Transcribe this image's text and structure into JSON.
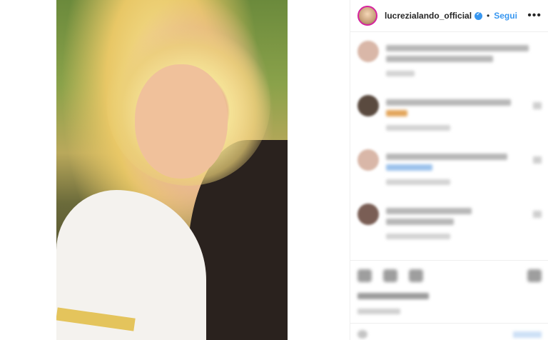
{
  "post": {
    "username": "lucrezialando_official",
    "follow_label": "Segui",
    "separator": "•",
    "more_label": "•••"
  },
  "colors": {
    "follow": "#3897f0",
    "verified": "#3897f0",
    "story_ring": "#d6249f"
  }
}
